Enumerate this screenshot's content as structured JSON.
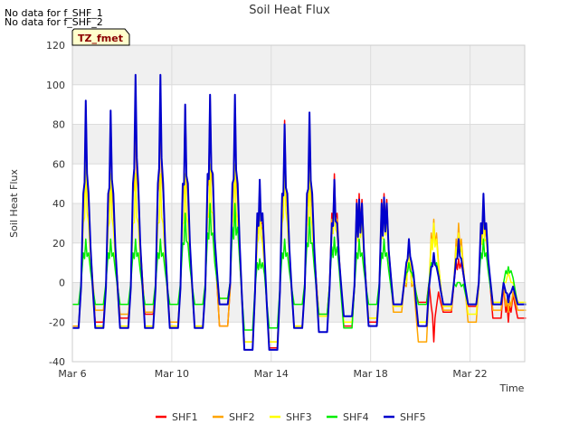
{
  "notes": [
    "No data for f_SHF_1",
    "No data for f_SHF_2"
  ],
  "chart_data": {
    "type": "line",
    "title": "Soil Heat Flux",
    "xlabel": "Time",
    "ylabel": "Soil Heat Flux",
    "badge": "TZ_fmet",
    "xlim": [
      6.0,
      24.2
    ],
    "ylim": [
      -40,
      120
    ],
    "yticks": [
      -40,
      -20,
      0,
      20,
      40,
      60,
      80,
      100,
      120
    ],
    "xticks": [
      {
        "x": 6,
        "label": "Mar 6"
      },
      {
        "x": 10,
        "label": "Mar 10"
      },
      {
        "x": 14,
        "label": "Mar 14"
      },
      {
        "x": 18,
        "label": "Mar 18"
      },
      {
        "x": 22,
        "label": "Mar 22"
      }
    ],
    "grid": true,
    "legend_position": "bottom",
    "days": [
      6.3,
      7.3,
      8.3,
      9.3,
      10.3,
      11.3,
      12.3,
      13.3,
      14.3,
      15.3,
      16.3,
      17.3,
      18.3,
      19.3,
      20.3,
      21.3,
      22.3,
      23.3
    ],
    "series": [
      {
        "name": "SHF1",
        "color": "#ff0000",
        "width": 1.5,
        "peaks": [
          90,
          85,
          90,
          93,
          90,
          95,
          90,
          50,
          82,
          78,
          55,
          45,
          45,
          20,
          -30,
          12,
          40,
          -20
        ],
        "second": [
          42,
          40,
          48,
          48,
          45,
          50,
          45,
          30,
          40,
          40,
          35,
          42,
          42,
          0,
          -12,
          10,
          30,
          -15
        ],
        "troughs": [
          -23,
          -20,
          -18,
          -16,
          -22,
          -23,
          -22,
          -34,
          -33,
          -23,
          -17,
          -22,
          -20,
          -12,
          -10,
          -15,
          -12,
          -18
        ]
      },
      {
        "name": "SHF2",
        "color": "#ffa500",
        "width": 1.5,
        "peaks": [
          85,
          80,
          88,
          90,
          88,
          92,
          90,
          45,
          75,
          75,
          50,
          42,
          42,
          18,
          32,
          30,
          38,
          -15
        ],
        "second": [
          40,
          38,
          45,
          45,
          42,
          48,
          42,
          28,
          38,
          38,
          32,
          40,
          40,
          -2,
          25,
          22,
          28,
          -12
        ],
        "troughs": [
          -22,
          -14,
          -16,
          -15,
          -20,
          -22,
          -22,
          -30,
          -30,
          -22,
          -16,
          -20,
          -18,
          -15,
          -30,
          -14,
          -20,
          -14
        ]
      },
      {
        "name": "SHF3",
        "color": "#ffff00",
        "width": 1.5,
        "peaks": [
          60,
          55,
          55,
          55,
          55,
          60,
          60,
          40,
          60,
          55,
          45,
          38,
          40,
          15,
          30,
          25,
          35,
          5
        ],
        "second": [
          30,
          28,
          30,
          30,
          30,
          35,
          30,
          20,
          30,
          28,
          25,
          30,
          32,
          0,
          22,
          18,
          22,
          0
        ],
        "troughs": [
          -23,
          -22,
          -22,
          -22,
          -22,
          -22,
          -8,
          -30,
          -30,
          -22,
          -17,
          -20,
          -18,
          -12,
          -20,
          -12,
          -16,
          -10
        ]
      },
      {
        "name": "SHF4",
        "color": "#00ee00",
        "width": 1.5,
        "peaks": [
          22,
          22,
          22,
          22,
          35,
          40,
          40,
          12,
          22,
          33,
          23,
          22,
          22,
          10,
          15,
          0,
          22,
          8
        ],
        "second": [
          15,
          15,
          15,
          15,
          20,
          25,
          28,
          10,
          15,
          20,
          18,
          15,
          15,
          5,
          10,
          -2,
          15,
          6
        ],
        "troughs": [
          -11,
          -11,
          -11,
          -11,
          -11,
          -11,
          -8,
          -24,
          -23,
          -11,
          -16,
          -23,
          -11,
          -11,
          -11,
          -11,
          -11,
          -11
        ]
      },
      {
        "name": "SHF5",
        "color": "#0000cc",
        "width": 2,
        "peaks": [
          92,
          87,
          105,
          105,
          90,
          95,
          95,
          52,
          80,
          86,
          52,
          42,
          43,
          22,
          15,
          22,
          45,
          -10
        ],
        "second": [
          45,
          45,
          50,
          50,
          50,
          55,
          50,
          35,
          45,
          45,
          30,
          40,
          40,
          10,
          8,
          12,
          30,
          -5
        ],
        "troughs": [
          -23,
          -23,
          -23,
          -23,
          -23,
          -23,
          -11,
          -34,
          -34,
          -23,
          -25,
          -17,
          -22,
          -11,
          -22,
          -11,
          -11,
          -11
        ]
      }
    ]
  }
}
